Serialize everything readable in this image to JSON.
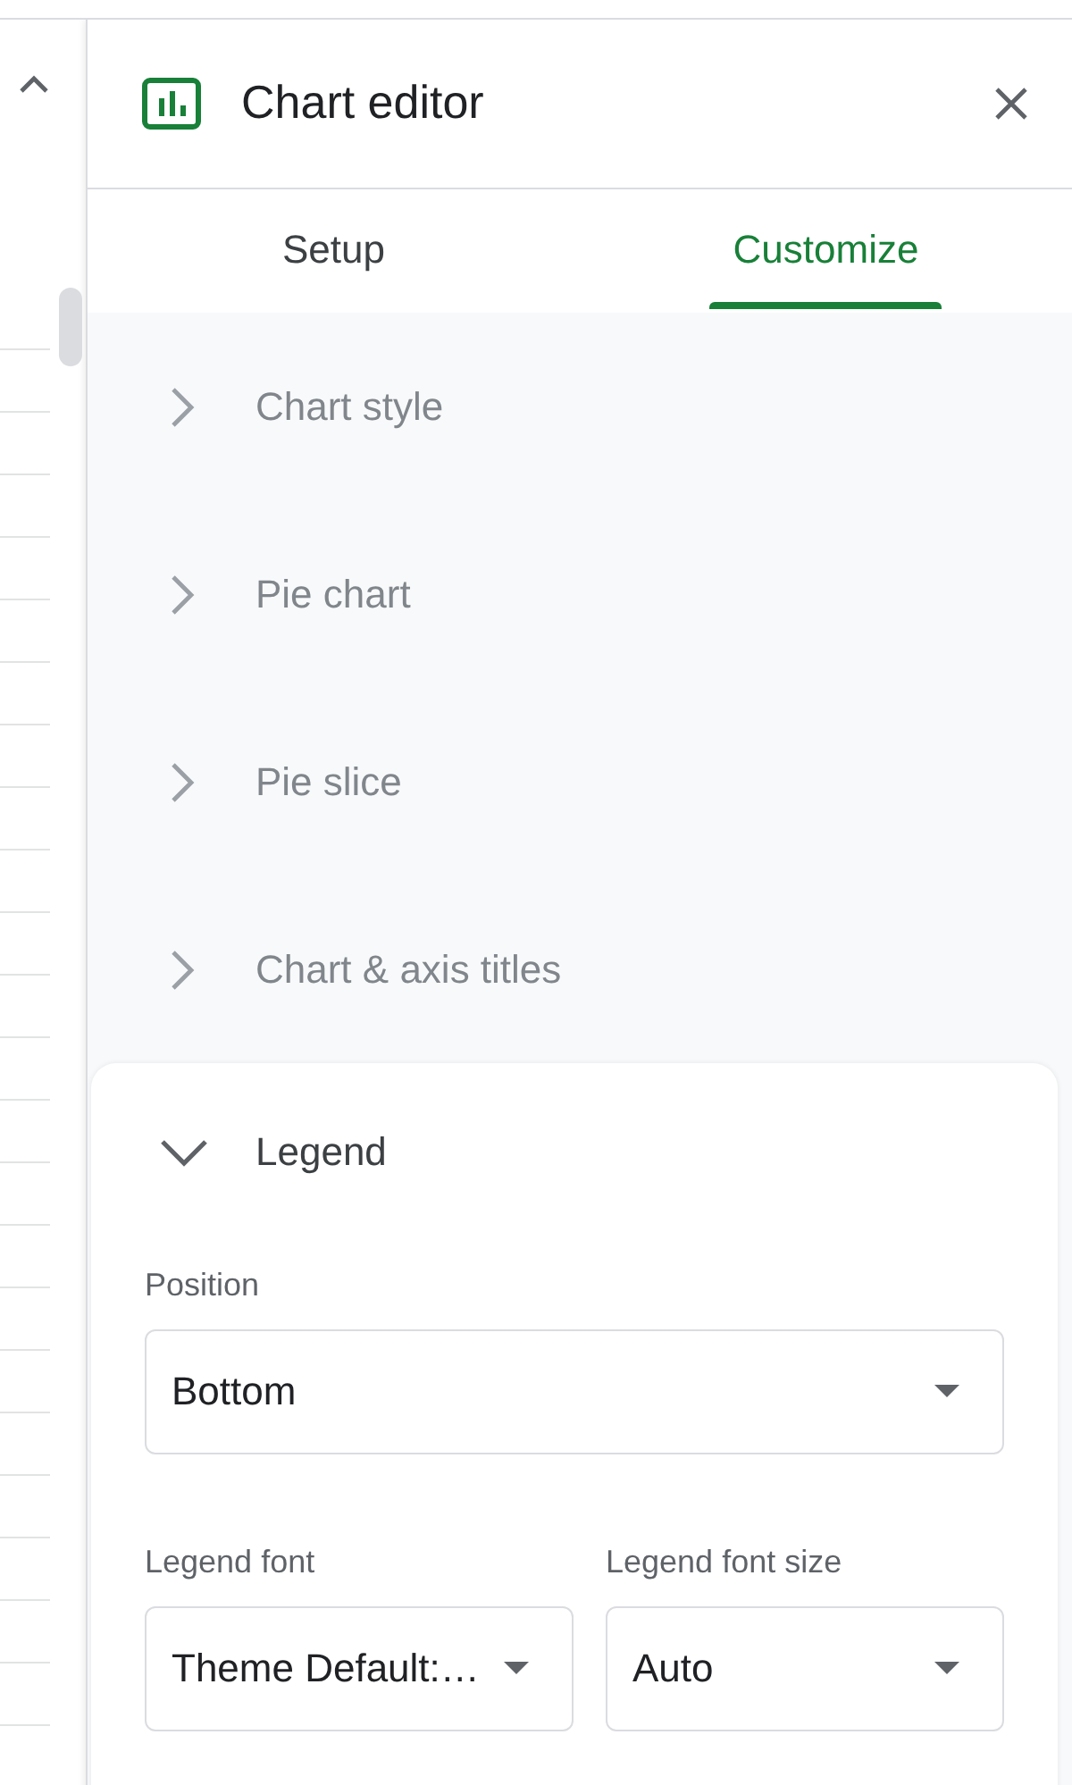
{
  "panel": {
    "title": "Chart editor"
  },
  "tabs": [
    {
      "label": "Setup",
      "selected": false
    },
    {
      "label": "Customize",
      "selected": true
    }
  ],
  "sections": [
    {
      "title": "Chart style",
      "expanded": false
    },
    {
      "title": "Pie chart",
      "expanded": false
    },
    {
      "title": "Pie slice",
      "expanded": false
    },
    {
      "title": "Chart & axis titles",
      "expanded": false
    },
    {
      "title": "Legend",
      "expanded": true,
      "rows": [
        [
          {
            "label": "Position",
            "value": "Bottom"
          }
        ],
        [
          {
            "label": "Legend font",
            "value": "Theme Default:…"
          },
          {
            "label": "Legend font size",
            "value": "Auto"
          }
        ]
      ]
    }
  ]
}
